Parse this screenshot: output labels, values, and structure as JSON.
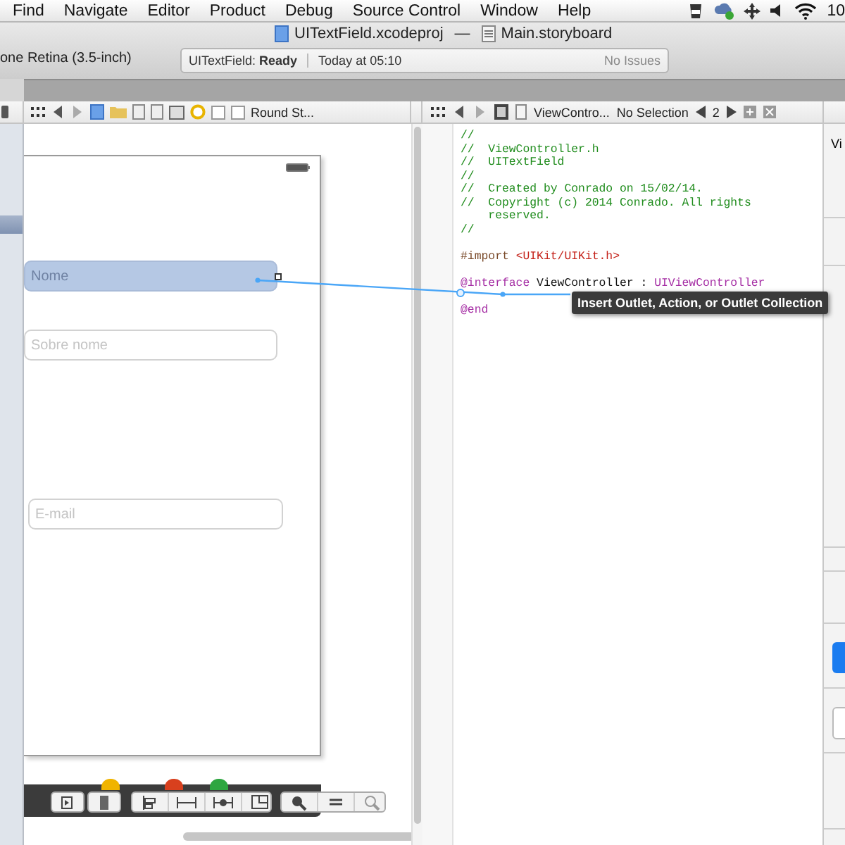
{
  "menu_bar": {
    "items": [
      "Find",
      "Navigate",
      "Editor",
      "Product",
      "Debug",
      "Source Control",
      "Window",
      "Help"
    ],
    "clock": "10"
  },
  "window": {
    "project": "UITextField.xcodeproj",
    "separator": "—",
    "file": "Main.storyboard",
    "scheme": "one Retina (3.5-inch)"
  },
  "activity": {
    "project": "UITextField:",
    "state": "Ready",
    "time": "Today at 05:10",
    "issues": "No Issues"
  },
  "left_jump_bar": {
    "last": "Round St..."
  },
  "right_jump_bar": {
    "file": "ViewContro...",
    "selection": "No Selection",
    "counter": "2"
  },
  "scene": {
    "fields": [
      {
        "placeholder": "Nome",
        "selected": true
      },
      {
        "placeholder": "Sobre nome",
        "selected": false
      },
      {
        "placeholder": "E-mail",
        "selected": false
      }
    ]
  },
  "code": {
    "lines": [
      {
        "segments": [
          {
            "kind": "comment",
            "text": "//"
          }
        ]
      },
      {
        "segments": [
          {
            "kind": "comment",
            "text": "//  ViewController.h"
          }
        ]
      },
      {
        "segments": [
          {
            "kind": "comment",
            "text": "//  UITextField"
          }
        ]
      },
      {
        "segments": [
          {
            "kind": "comment",
            "text": "//"
          }
        ]
      },
      {
        "segments": [
          {
            "kind": "comment",
            "text": "//  Created by Conrado on 15/02/14."
          }
        ]
      },
      {
        "segments": [
          {
            "kind": "comment",
            "text": "//  Copyright (c) 2014 Conrado. All rights"
          }
        ]
      },
      {
        "segments": [
          {
            "kind": "comment",
            "text": "    reserved."
          }
        ]
      },
      {
        "segments": [
          {
            "kind": "comment",
            "text": "//"
          }
        ]
      },
      {
        "segments": [
          {
            "kind": "directive",
            "text": "#import "
          },
          {
            "kind": "string",
            "text": "<UIKit/UIKit.h>"
          }
        ],
        "blank_before": true
      },
      {
        "segments": [
          {
            "kind": "keyword",
            "text": "@interface"
          },
          {
            "kind": "plain",
            "text": " ViewController : "
          },
          {
            "kind": "keyword",
            "text": "UIViewController"
          }
        ],
        "blank_before": true
      },
      {
        "segments": [
          {
            "kind": "keyword",
            "text": "@end"
          }
        ],
        "blank_before": true
      }
    ]
  },
  "tooltip": "Insert Outlet, Action, or Outlet Collection",
  "inspector": {
    "title": "Vi"
  }
}
